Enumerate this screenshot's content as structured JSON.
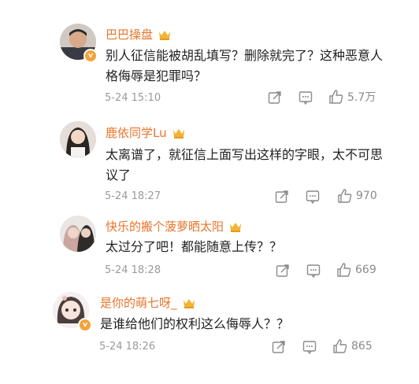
{
  "comments": [
    {
      "username": "巴巴操盘",
      "text": "别人征信能被胡乱填写？删除就完了？这种恶意人格侮辱是犯罪吗？",
      "timestamp": "5-24 15:10",
      "likes": "5.7万"
    },
    {
      "username": "鹿依同学Lu",
      "text": "太离谱了，就征信上面写出这样的字眼，太不可思议了",
      "timestamp": "5-24 18:27",
      "likes": "970"
    },
    {
      "username": "快乐的搬个菠萝晒太阳",
      "text": "太过分了吧！都能随意上传？？",
      "timestamp": "5-24 18:28",
      "likes": "669"
    },
    {
      "username": "是你的萌七呀_",
      "text": "是谁给他们的权利这么侮辱人？？",
      "timestamp": "5-24 18:26",
      "likes": "865"
    }
  ],
  "colors": {
    "username": "#e8742a",
    "badge": "#f2a33a",
    "meta": "#9a9a9a"
  }
}
